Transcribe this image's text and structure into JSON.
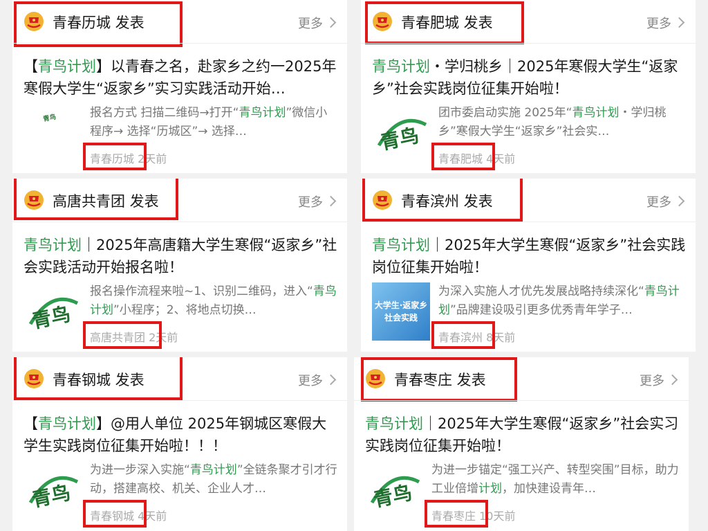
{
  "accent_color": "#2e9c4e",
  "highlight_color": "#e01818",
  "more_label": "更多",
  "cards": [
    {
      "header": "青春历城 发表",
      "title_pre": "【",
      "title_hl": "青鸟计划",
      "title_post": "】以青春之名，赴家乡之约一2025年寒假大学生“返家乡”实习实践活动开始…",
      "desc_pre": "报名方式 扫描二维码→打开“",
      "desc_hl": "青鸟计划",
      "desc_post": "”微信小程序→ 选择“历城区”→ 选择…",
      "source": "青春历城",
      "time": "2天前",
      "thumb_icon": "qingniao-logo-icon"
    },
    {
      "header": "青春肥城 发表",
      "title_pre": "",
      "title_hl": "青鸟计划",
      "title_post": "・学归桃乡｜2025年寒假大学生“返家乡”社会实践岗位征集开始啦！",
      "desc_pre": "团市委启动实施 2025年“",
      "desc_hl": "青鸟计划",
      "desc_post": "・学归桃乡”寒假大学生“返家乡”社会实…",
      "source": "青春肥城",
      "time": "4天前",
      "thumb_icon": "qingniao-logo-icon"
    },
    {
      "header": "高唐共青团 发表",
      "title_pre": "",
      "title_hl": "青鸟计划",
      "title_post": "｜2025年高唐籍大学生寒假“返家乡”社会实践活动开始报名啦！",
      "desc_pre": "报名操作流程来啦~1、识别二维码，进入“",
      "desc_hl": "青鸟计划",
      "desc_post": "”小程序；2、将地点切换…",
      "source": "高唐共青团",
      "time": "2天前",
      "thumb_icon": "qingniao-logo-icon"
    },
    {
      "header": "青春滨州 发表",
      "title_pre": "",
      "title_hl": "青鸟计划",
      "title_post": "｜2025年大学生寒假“返家乡”社会实践岗位征集开始啦！",
      "desc_pre": "为深入实施人才优先发展战略持续深化“",
      "desc_hl": "青鸟计划",
      "desc_post": "”品牌建设吸引更多优秀青年学子…",
      "source": "青春滨州",
      "time": "8天前",
      "thumb_text": "大学生·返家乡社会实践"
    },
    {
      "header": "青春钢城 发表",
      "title_pre": "【",
      "title_hl": "青鸟计划",
      "title_post": "】@用人单位 2025年钢城区寒假大学生实践岗位征集开始啦！！！",
      "desc_pre": "为进一步深入实施“",
      "desc_hl": "青鸟计划",
      "desc_post": "”全链条聚才引才行动，搭建高校、机关、企业人才…",
      "source": "青春钢城",
      "time": "4天前",
      "thumb_icon": "qingniao-logo-icon"
    },
    {
      "header": "青春枣庄 发表",
      "title_pre": "",
      "title_hl": "青鸟计划",
      "title_post": "｜2025年大学生寒假“返家乡”社会实习实践岗位征集开始啦！",
      "desc_pre": "为进一步锚定“强工兴产、转型突围”目标，助力工业倍增",
      "desc_hl": "计划",
      "desc_post": "，加快建设青年…",
      "source": "青春枣庄",
      "time": "10天前",
      "thumb_icon": "qingniao-logo-icon"
    }
  ]
}
